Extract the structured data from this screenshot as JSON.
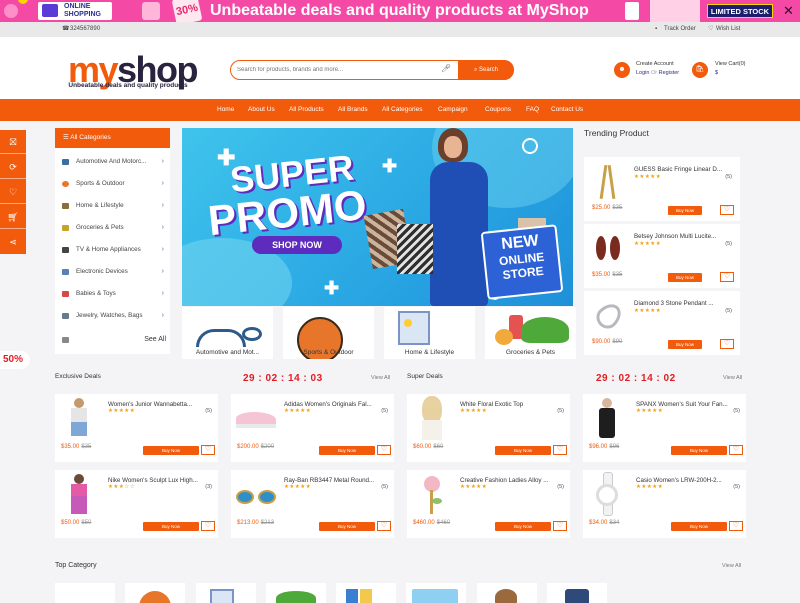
{
  "promo": {
    "online_line1": "ONLINE",
    "online_line2": "SHOPPING",
    "discount": "30%",
    "headline": "Unbeatable deals and quality products at MyShop",
    "limited": "LIMITED STOCK",
    "close": "✕"
  },
  "topbar": {
    "phone": "324567890",
    "track": "Track Order",
    "wishlist": "Wish List"
  },
  "header": {
    "logo_m": "my",
    "logo_s": "shop",
    "tagline": "Unbeatable deals and quality products",
    "search_placeholder": "Search for products, brands and more...",
    "search_button": "Search",
    "account_line1": "Create Account",
    "login": "Login",
    "or": "Or",
    "register": "Register",
    "view_cart": "View Cart(0)",
    "cart_total": "$"
  },
  "nav": [
    "Home",
    "About Us",
    "All Products",
    "All Brands",
    "All Categories",
    "Campaign",
    "Coupons",
    "FAQ",
    "Contact Us"
  ],
  "badge": "50%",
  "categories": {
    "title": "All Categories",
    "items": [
      "Automotive And Motorc...",
      "Sports & Outdoor",
      "Home & Lifestyle",
      "Groceries & Pets",
      "TV & Home Appliances",
      "Electronic Devices",
      "Babies & Toys",
      "Jewelry, Watches, Bags"
    ],
    "see_all": "See All",
    "icon_colors": [
      "#3b6ea5",
      "#e8762a",
      "#8a6d3b",
      "#c9a227",
      "#444",
      "#5a7fb5",
      "#d14b4b",
      "#6a7a8a"
    ]
  },
  "hero": {
    "super": "SUPER",
    "promo": "PROMO",
    "shop_now": "SHOP NOW",
    "new": "NEW",
    "online": "ONLINE",
    "store": "STORE"
  },
  "tiles": [
    "Automotive and Mot...",
    "Sports & Outdoor",
    "Home & Lifestyle",
    "Groceries & Pets"
  ],
  "trending": {
    "title": "Trending Product",
    "items": [
      {
        "name": "GUESS Basic Fringe Linear D...",
        "rating": "★★★★★",
        "reviews": "(5)",
        "price": "$25.00",
        "old": "$35",
        "button": "Buy Now"
      },
      {
        "name": "Betsey Johnson Multi Lucite...",
        "rating": "★★★★★",
        "reviews": "(5)",
        "price": "$35.00",
        "old": "$35",
        "button": "Buy Now"
      },
      {
        "name": "Diamond 3 Stone Pendant ...",
        "rating": "★★★★★",
        "reviews": "(5)",
        "price": "$90.00",
        "old": "$90",
        "button": "Buy Now"
      }
    ]
  },
  "exclusive": {
    "title": "Exclusive Deals",
    "timer": "29 : 02 : 14 : 03",
    "view_all": "View All",
    "items": [
      {
        "name": "Women's Junior Wannabetta...",
        "rating": "★★★★★",
        "reviews": "(5)",
        "price": "$35.00",
        "old": "$35",
        "button": "Buy Now"
      },
      {
        "name": "Adidas Women's Originals Fal...",
        "rating": "★★★★★",
        "reviews": "(5)",
        "price": "$200.00",
        "old": "$200",
        "button": "Buy Now"
      },
      {
        "name": "Nike Women's Sculpt Lux High...",
        "rating": "★★★☆☆",
        "reviews": "(3)",
        "price": "$50.00",
        "old": "$50",
        "button": "Buy Now"
      },
      {
        "name": "Ray-Ban RB3447 Metal Round...",
        "rating": "★★★★★",
        "reviews": "(5)",
        "price": "$213.00",
        "old": "$213",
        "button": "Buy Now"
      }
    ]
  },
  "super": {
    "title": "Super Deals",
    "timer": "29 : 02 : 14 : 02",
    "view_all": "View All",
    "items": [
      {
        "name": "White Floral Exotic Top",
        "rating": "★★★★★",
        "reviews": "(5)",
        "price": "$60.00",
        "old": "$60",
        "button": "Buy Now"
      },
      {
        "name": "SPANX Women's Suit Your Fan...",
        "rating": "★★★★★",
        "reviews": "(5)",
        "price": "$96.00",
        "old": "$96",
        "button": "Buy Now"
      },
      {
        "name": "Creative Fashion Ladies Alloy ...",
        "rating": "★★★★★",
        "reviews": "(5)",
        "price": "$460.00",
        "old": "$460",
        "button": "Buy Now"
      },
      {
        "name": "Casio Women's LRW-200H-2...",
        "rating": "★★★★★",
        "reviews": "(5)",
        "price": "$34.00",
        "old": "$34",
        "button": "Buy Now"
      }
    ]
  },
  "top_category": {
    "title": "Top Category",
    "view_all": "View All"
  },
  "colors": {
    "accent": "#f25a0c",
    "promo_bg": "#f44aa5",
    "timer": "#e11d24",
    "star": "#f59e0b",
    "navy": "#2b2f8f"
  }
}
